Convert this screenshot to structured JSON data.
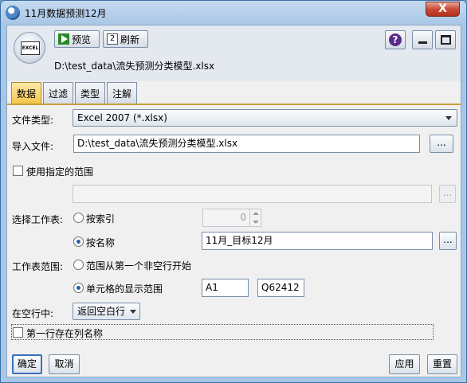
{
  "window": {
    "title": "11月数据预测12月",
    "close_label": "X"
  },
  "toolbar": {
    "preview_label": "预览",
    "refresh_label": "刷新",
    "help_label": "?",
    "node_icon_text": "EXCEL"
  },
  "file_path_label": "D:\\test_data\\流失预测分类模型.xlsx",
  "tabs": [
    {
      "label": "数据",
      "active": true
    },
    {
      "label": "过滤",
      "active": false
    },
    {
      "label": "类型",
      "active": false
    },
    {
      "label": "注解",
      "active": false
    }
  ],
  "form": {
    "file_type_label": "文件类型:",
    "file_type_value": "Excel 2007 (*.xlsx)",
    "import_file_label": "导入文件:",
    "import_file_value": "D:\\test_data\\流失预测分类模型.xlsx",
    "browse_label": "...",
    "use_range_label": "使用指定的范围",
    "range_value": "",
    "select_sheet_label": "选择工作表:",
    "by_index_label": "按索引",
    "index_value": "0",
    "by_name_label": "按名称",
    "sheet_name_value": "11月_目标12月",
    "sheet_range_label": "工作表范围:",
    "range_from_first_label": "范围从第一个非空行开始",
    "cell_display_range_label": "单元格的显示范围",
    "range_start_value": "A1",
    "range_end_value": "Q62412",
    "on_blank_rows_label": "在空行中:",
    "on_blank_rows_value": "返回空白行",
    "first_row_names_label": "第一行存在列名称"
  },
  "buttons": {
    "ok_label": "确定",
    "cancel_label": "取消",
    "apply_label": "应用",
    "reset_label": "重置"
  }
}
